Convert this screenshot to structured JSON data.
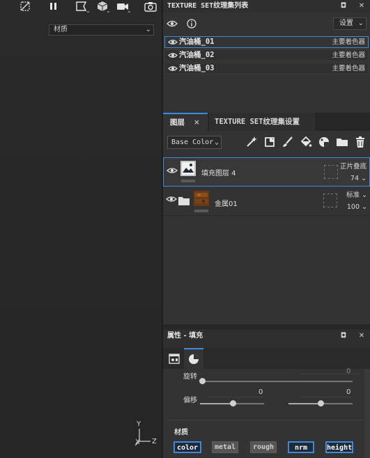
{
  "viewport": {
    "material_select": "材质",
    "axis": {
      "y": "Y",
      "x": "X",
      "z": "Z"
    },
    "toolbar_icons": [
      "visibility-off-icon",
      "pause-icon",
      "camera-mode-icon",
      "cube-icon",
      "video-icon",
      "screenshot-icon"
    ]
  },
  "texture_set_list": {
    "title": "TEXTURE SET纹理集列表",
    "settings_label": "设置",
    "items": [
      {
        "name": "汽油桶_01",
        "shader": "主要着色器",
        "selected": true
      },
      {
        "name": "汽油桶_02",
        "shader": "主要着色器",
        "selected": false
      },
      {
        "name": "汽油桶_03",
        "shader": "主要着色器",
        "selected": false
      }
    ]
  },
  "layers": {
    "tab_layers": "图层",
    "tab_close": "×",
    "tab_texture_set_settings": "TEXTURE SET纹理集设置",
    "channel": "Base Color",
    "items": [
      {
        "name": "填充图层 4",
        "blend": "正片叠底",
        "opacity": "74",
        "selected": true
      },
      {
        "name": "金属01",
        "blend": "标准",
        "opacity": "100",
        "selected": false
      }
    ]
  },
  "properties": {
    "title": "属性 - 填充",
    "rotation_label": "旋转",
    "rotation_value": "0",
    "offset_label": "偏移",
    "offset_u": "0",
    "offset_v": "0",
    "material_label": "材质",
    "channels": [
      {
        "label": "color",
        "enabled": true
      },
      {
        "label": "metal",
        "enabled": false
      },
      {
        "label": "rough",
        "enabled": false
      },
      {
        "label": "nrm",
        "enabled": true
      },
      {
        "label": "height",
        "enabled": true
      }
    ]
  },
  "colors": {
    "accent": "#3d8be0",
    "panel": "#333333",
    "background": "#2b2b2b"
  }
}
